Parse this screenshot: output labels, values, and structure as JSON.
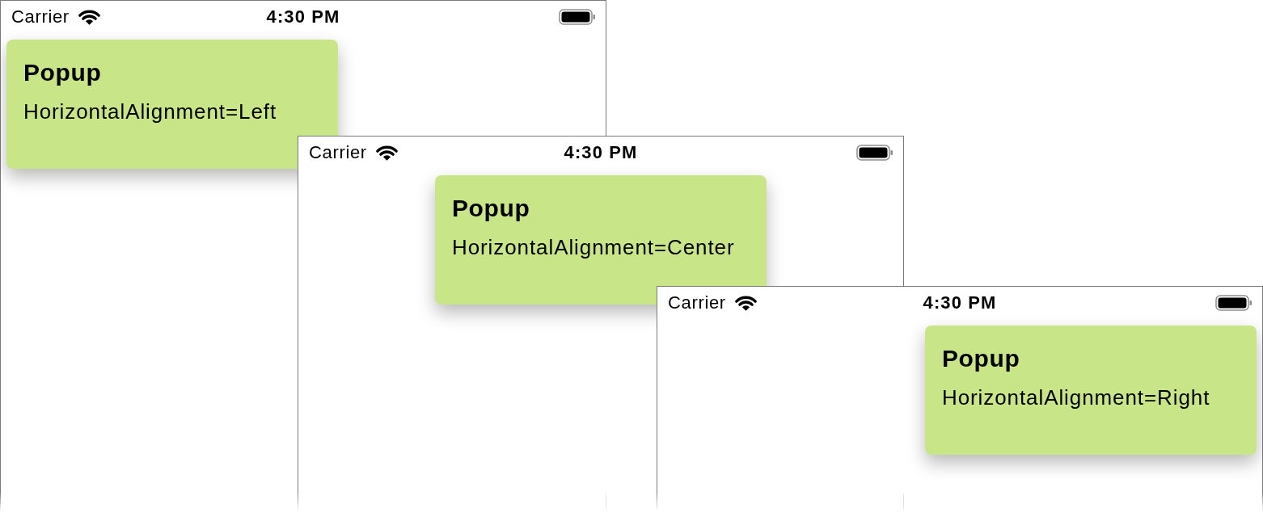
{
  "screens": [
    {
      "status_bar": {
        "carrier": "Carrier",
        "time": "4:30 PM"
      },
      "popup": {
        "title": "Popup",
        "text": "HorizontalAlignment=Left",
        "kind": "left"
      }
    },
    {
      "status_bar": {
        "carrier": "Carrier",
        "time": "4:30 PM"
      },
      "popup": {
        "title": "Popup",
        "text": "HorizontalAlignment=Center",
        "kind": "center"
      }
    },
    {
      "status_bar": {
        "carrier": "Carrier",
        "time": "4:30 PM"
      },
      "popup": {
        "title": "Popup",
        "text": "HorizontalAlignment=Right",
        "kind": "right"
      }
    }
  ]
}
